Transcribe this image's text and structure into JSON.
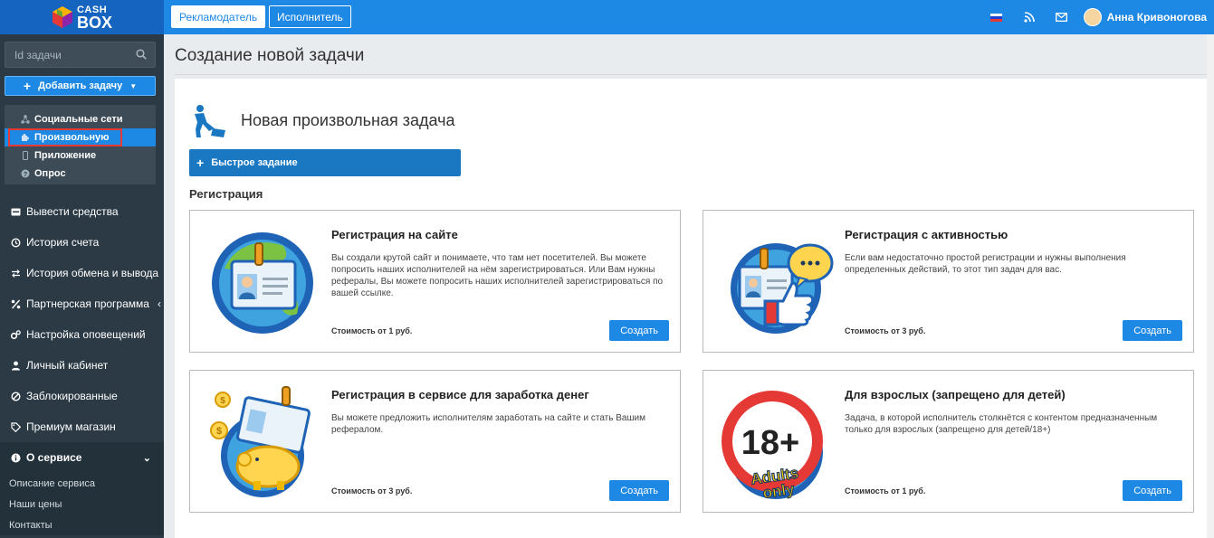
{
  "brand": {
    "logo_line1": "CASH",
    "logo_line2": "BOX"
  },
  "header": {
    "role_advertiser": "Рекламодатель",
    "role_executor": "Исполнитель",
    "user_name": "Анна Кривоногова"
  },
  "sidebar": {
    "search_placeholder": "Id задачи",
    "add_task_label": "Добавить задачу",
    "submenu": [
      {
        "label": "Социальные сети",
        "active": false
      },
      {
        "label": "Произвольную",
        "active": true
      },
      {
        "label": "Приложение",
        "active": false
      },
      {
        "label": "Опрос",
        "active": false
      }
    ],
    "menu": [
      {
        "label": "Вывести средства",
        "icon": "wallet-icon"
      },
      {
        "label": "История счета",
        "icon": "history-icon"
      },
      {
        "label": "История обмена и вывода",
        "icon": "exchange-icon"
      },
      {
        "label": "Партнерская программа",
        "icon": "percent-icon",
        "chevron": "‹"
      },
      {
        "label": "Настройка оповещений",
        "icon": "cogs-icon"
      },
      {
        "label": "Личный кабинет",
        "icon": "user-icon"
      },
      {
        "label": "Заблокированные",
        "icon": "ban-icon"
      },
      {
        "label": "Премиум магазин",
        "icon": "tag-icon"
      }
    ],
    "about": {
      "label": "О сервисе",
      "links": [
        "Описание сервиса",
        "Наши цены",
        "Контакты"
      ]
    }
  },
  "main": {
    "page_title": "Создание новой задачи",
    "task_title": "Новая произвольная задача",
    "quick_task_label": "Быстрое задание",
    "section_label": "Регистрация",
    "cards": [
      {
        "title": "Регистрация на сайте",
        "desc": "Вы создали крутой сайт и понимаете, что там нет посетителей. Вы можете попросить наших исполнителей на нём зарегистрироваться. Или Вам нужны рефералы, Вы можете попросить наших исполнителей зарегистрироваться по вашей ссылке.",
        "price": "Стоимость от 1 руб.",
        "button": "Создать",
        "illustration": "globe-badge-icon"
      },
      {
        "title": "Регистрация с активностью",
        "desc": "Если вам недостаточно простой регистрации и нужны выполнения определенных действий, то этот тип задач для вас.",
        "price": "Стоимость от 3 руб.",
        "button": "Создать",
        "illustration": "thumbs-up-badge-icon"
      },
      {
        "title": "Регистрация в сервисе для заработка денег",
        "desc": "Вы можете предложить исполнителям заработать на сайте и стать Вашим рефералом.",
        "price": "Стоимость от 3 руб.",
        "button": "Создать",
        "illustration": "piggy-bank-icon"
      },
      {
        "title": "Для взрослых (запрещено для детей)",
        "desc": "Задача, в которой исполнитель столкнётся с контентом предназначенным только для взрослых (запрещено для детей/18+)",
        "price": "Стоимость от 1 руб.",
        "button": "Создать",
        "illustration": "adults-only-icon",
        "badge_number": "18+",
        "badge_text": "Adults only"
      }
    ]
  },
  "colors": {
    "topbar": "#1e88e5",
    "sidebar": "#2b3a45",
    "accent": "#1e88e5",
    "highlight": "#e53935"
  }
}
